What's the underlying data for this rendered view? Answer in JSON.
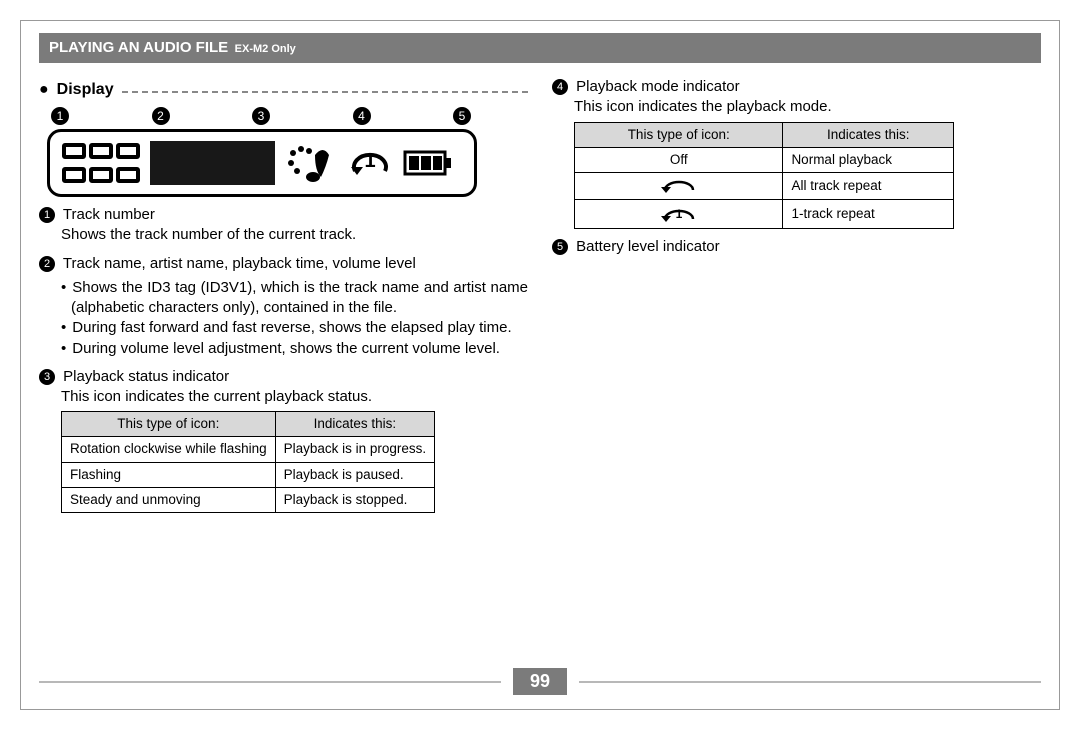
{
  "header": {
    "title": "PLAYING AN AUDIO FILE",
    "subtitle": "EX-M2 Only"
  },
  "section": {
    "display_heading": "Display"
  },
  "callout_numbers": [
    "1",
    "2",
    "3",
    "4",
    "5"
  ],
  "items": {
    "i1": {
      "num": "1",
      "title": "Track number",
      "desc": "Shows the track number of the current track."
    },
    "i2": {
      "num": "2",
      "title": "Track name, artist name, playback time, volume level",
      "bullets": [
        "Shows the ID3 tag (ID3V1), which is the track name and artist name (alphabetic characters only), contained in the file.",
        "During fast forward and fast reverse, shows the elapsed play time.",
        "During volume level adjustment, shows the current volume level."
      ]
    },
    "i3": {
      "num": "3",
      "title": "Playback status indicator",
      "desc": "This icon indicates the current playback status.",
      "table": {
        "headers": [
          "This type of icon:",
          "Indicates this:"
        ],
        "rows": [
          [
            "Rotation clockwise while flashing",
            "Playback is in progress."
          ],
          [
            "Flashing",
            "Playback is paused."
          ],
          [
            "Steady and unmoving",
            "Playback is stopped."
          ]
        ]
      }
    },
    "i4": {
      "num": "4",
      "title": "Playback mode indicator",
      "desc": "This icon indicates the playback mode.",
      "table": {
        "headers": [
          "This type of icon:",
          "Indicates this:"
        ],
        "rows": [
          {
            "icon": "off",
            "label": "Off",
            "meaning": "Normal playback"
          },
          {
            "icon": "repeat-all",
            "label": "",
            "meaning": "All track repeat"
          },
          {
            "icon": "repeat-1",
            "label": "",
            "meaning": "1-track repeat"
          }
        ]
      }
    },
    "i5": {
      "num": "5",
      "title": "Battery level indicator"
    }
  },
  "page_number": "99"
}
